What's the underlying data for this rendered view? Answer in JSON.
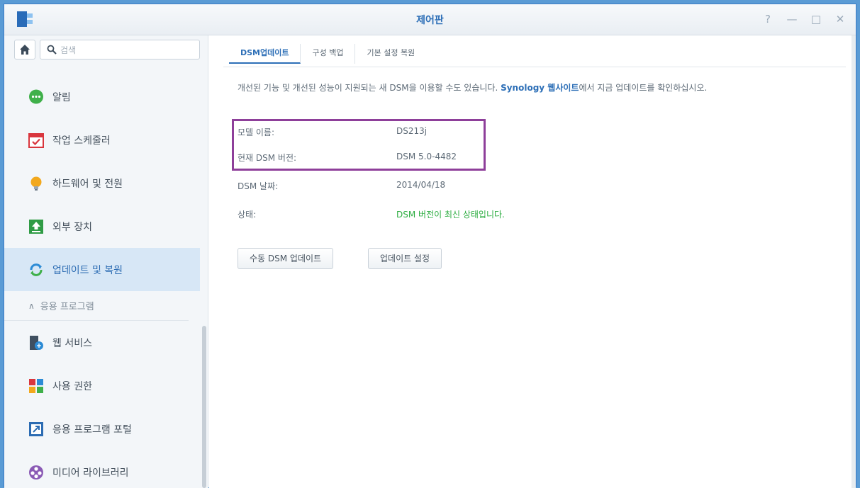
{
  "window": {
    "title": "제어판",
    "controls": [
      "?",
      "—",
      "□",
      "✕"
    ]
  },
  "search": {
    "placeholder": "검색"
  },
  "sidebar": {
    "items": [
      {
        "label": "알림",
        "icon": "chat-bubble-icon",
        "color": "#3fb04a"
      },
      {
        "label": "작업 스케줄러",
        "icon": "calendar-icon",
        "color": "#d9363e"
      },
      {
        "label": "하드웨어 및 전원",
        "icon": "lightbulb-icon",
        "color": "#f2a81d"
      },
      {
        "label": "외부 장치",
        "icon": "upload-icon",
        "color": "#2f9b45"
      },
      {
        "label": "업데이트 및 복원",
        "icon": "refresh-icon",
        "color": "#2c8bd5",
        "active": true
      }
    ],
    "section": {
      "label": "응용 프로그램",
      "icon": "chevron-up-icon"
    },
    "app_items": [
      {
        "label": "웹 서비스",
        "icon": "web-service-icon"
      },
      {
        "label": "사용 권한",
        "icon": "privileges-icon"
      },
      {
        "label": "응용 프로그램 포털",
        "icon": "app-portal-icon"
      },
      {
        "label": "미디어 라이브러리",
        "icon": "media-library-icon"
      }
    ]
  },
  "tabs": [
    {
      "label": "DSM업데이트",
      "active": true
    },
    {
      "label": "구성 백업"
    },
    {
      "label": "기본 설정 복원"
    }
  ],
  "main": {
    "description_before": "개선된 기능 및 개선된 성능이 지원되는 새 DSM을 이용할 수도 있습니다. ",
    "description_link": "Synology 웹사이트",
    "description_after": "에서 지금 업데이트를 확인하십시오.",
    "info": [
      {
        "label": "모델 이름:",
        "value": "DS213j"
      },
      {
        "label": "현재 DSM 버전:",
        "value": "DSM 5.0-4482"
      },
      {
        "label": "DSM 날짜:",
        "value": "2014/04/18"
      },
      {
        "label": "상태:",
        "value": "DSM 버전이 최신 상태입니다."
      }
    ],
    "buttons": {
      "manual_update": "수동 DSM 업데이트",
      "update_settings": "업데이트 설정"
    }
  },
  "colors": {
    "accent": "#2d6fb7",
    "status_ok": "#2fae43",
    "highlight": "#8e3f9a"
  }
}
